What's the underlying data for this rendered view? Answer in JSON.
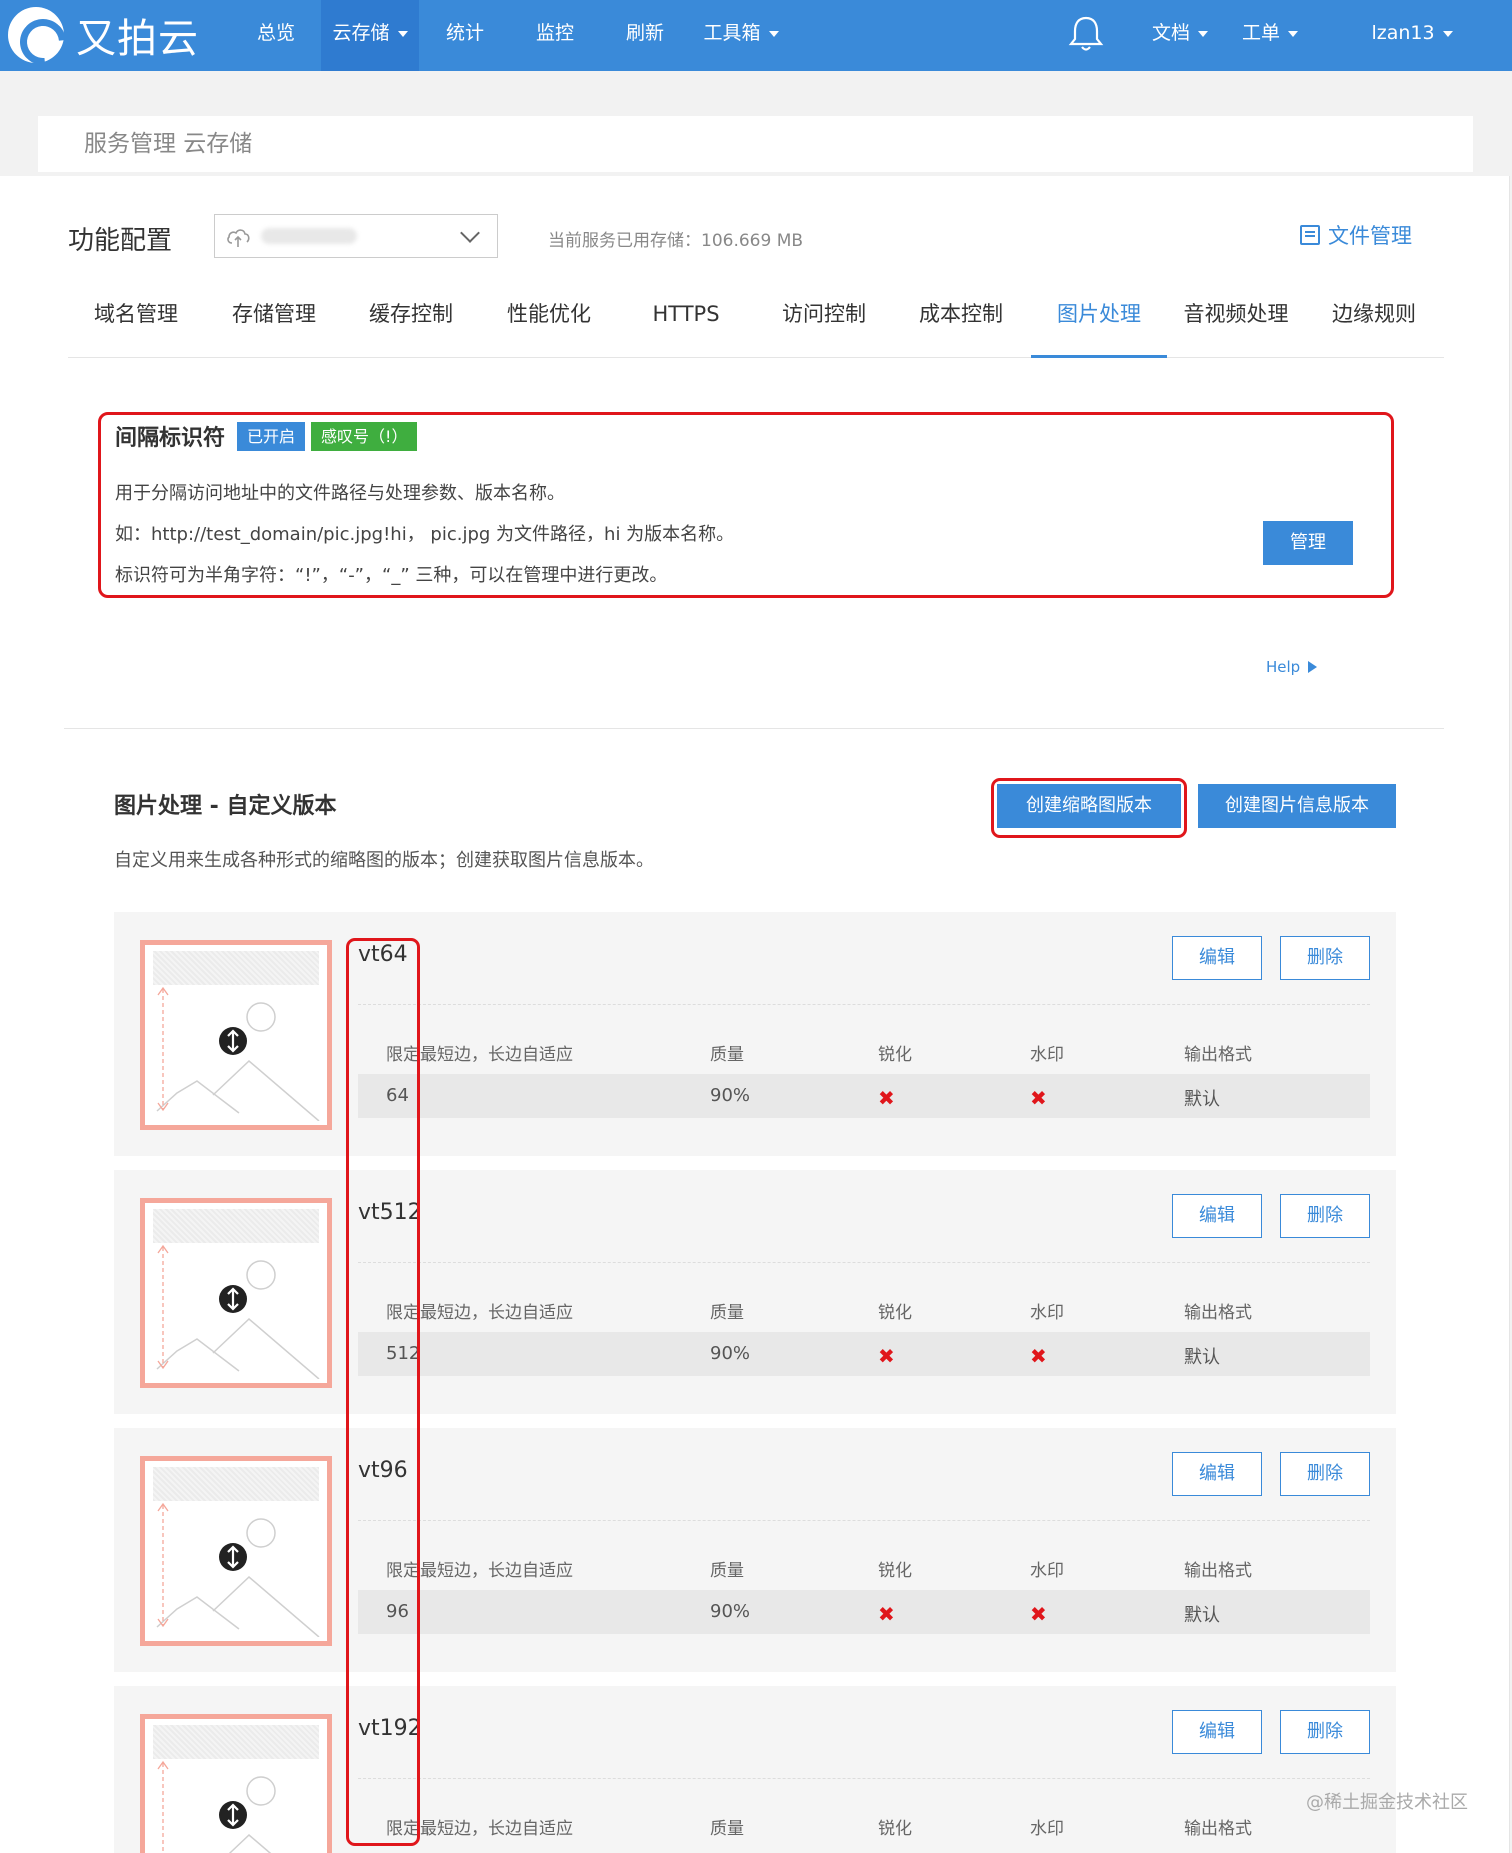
{
  "app": {
    "logo_text": "又拍云"
  },
  "nav": {
    "items": [
      {
        "label": "总览",
        "dropdown": false,
        "active": false
      },
      {
        "label": "云存储",
        "dropdown": true,
        "active": true
      },
      {
        "label": "统计",
        "dropdown": false,
        "active": false
      },
      {
        "label": "监控",
        "dropdown": false,
        "active": false
      },
      {
        "label": "刷新",
        "dropdown": false,
        "active": false
      },
      {
        "label": "工具箱",
        "dropdown": true,
        "active": false
      }
    ],
    "right": [
      {
        "label": "文档",
        "dropdown": true
      },
      {
        "label": "工单",
        "dropdown": true
      },
      {
        "label": "lzan13",
        "dropdown": true
      }
    ]
  },
  "breadcrumb": "服务管理 云存储",
  "config": {
    "title": "功能配置",
    "storage_text": "当前服务已用存储：106.669 MB",
    "file_mgmt_label": "文件管理"
  },
  "tabs": [
    {
      "label": "域名管理",
      "active": false
    },
    {
      "label": "存储管理",
      "active": false
    },
    {
      "label": "缓存控制",
      "active": false
    },
    {
      "label": "性能优化",
      "active": false
    },
    {
      "label": "HTTPS",
      "active": false
    },
    {
      "label": "访问控制",
      "active": false
    },
    {
      "label": "成本控制",
      "active": false
    },
    {
      "label": "图片处理",
      "active": true
    },
    {
      "label": "音视频处理",
      "active": false
    },
    {
      "label": "边缘规则",
      "active": false
    }
  ],
  "separator": {
    "title": "间隔标识符",
    "status_badge": "已开启",
    "symbol_badge": "感叹号（!）",
    "lines": [
      "用于分隔访问地址中的文件路径与处理参数、版本名称。",
      "如：http://test_domain/pic.jpg!hi，  pic.jpg 为文件路径，hi 为版本名称。",
      "标识符可为半角字符：“!”，“-”，“_” 三种，可以在管理中进行更改。"
    ],
    "manage_label": "管理"
  },
  "help_label": "Help",
  "image_processing": {
    "title": "图片处理 - 自定义版本",
    "description": "自定义用来生成各种形式的缩略图的版本；创建获取图片信息版本。",
    "create_thumb_label": "创建缩略图版本",
    "create_info_label": "创建图片信息版本",
    "columns": [
      "限定最短边，长边自适应",
      "质量",
      "锐化",
      "水印",
      "输出格式"
    ],
    "edit_label": "编辑",
    "delete_label": "删除",
    "versions": [
      {
        "name": "vt64",
        "size": "64",
        "quality": "90%",
        "sharpen": "✖",
        "watermark": "✖",
        "format": "默认"
      },
      {
        "name": "vt512",
        "size": "512",
        "quality": "90%",
        "sharpen": "✖",
        "watermark": "✖",
        "format": "默认"
      },
      {
        "name": "vt96",
        "size": "96",
        "quality": "90%",
        "sharpen": "✖",
        "watermark": "✖",
        "format": "默认"
      },
      {
        "name": "vt192"
      }
    ]
  },
  "watermark_text": "@稀土掘金技术社区",
  "colors": {
    "brand": "#3a8ad9",
    "highlight": "#e0161b",
    "badge_green": "#3fae3f"
  }
}
